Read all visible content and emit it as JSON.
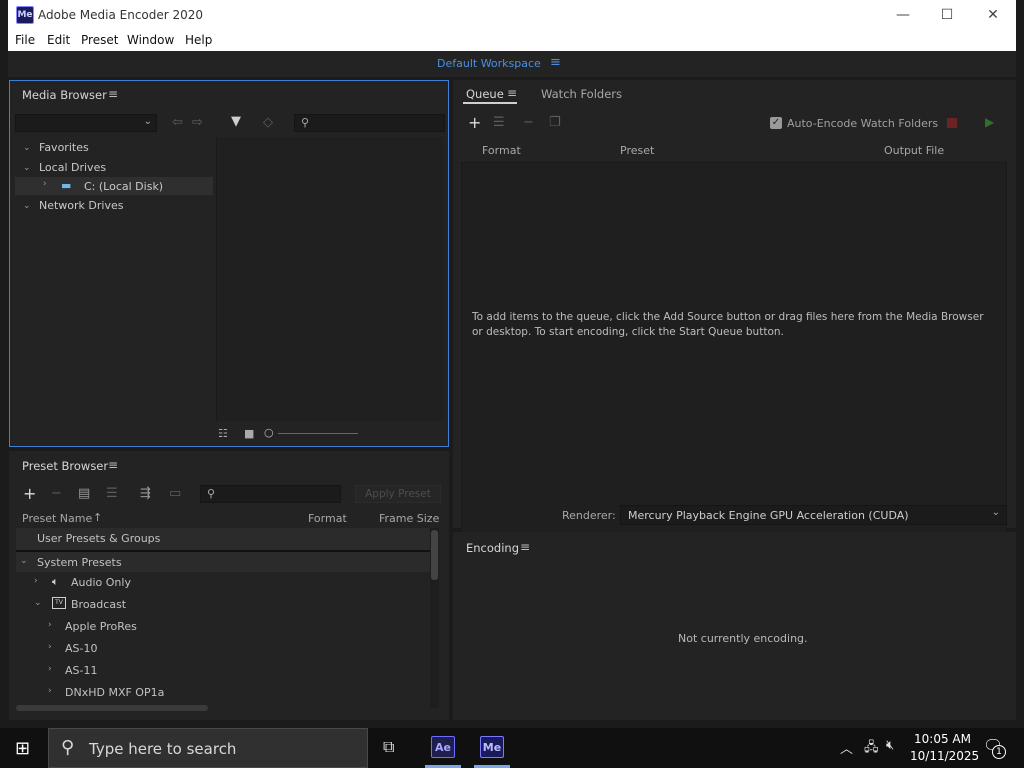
{
  "window": {
    "app_icon": "Me",
    "title": "Adobe Media Encoder 2020",
    "controls": {
      "minimize": "—",
      "maximize": "☐",
      "close": "✕"
    }
  },
  "menu": [
    "File",
    "Edit",
    "Preset",
    "Window",
    "Help"
  ],
  "workspace": {
    "label": "Default Workspace",
    "menu_icon": "≡"
  },
  "media_browser": {
    "title": "Media Browser",
    "tree": [
      {
        "label": "Favorites",
        "expanded": true
      },
      {
        "label": "Local Drives",
        "expanded": true
      },
      {
        "label": "C: (Local Disk)",
        "expanded": false
      },
      {
        "label": "Network Drives",
        "expanded": true
      }
    ]
  },
  "queue": {
    "tabs": [
      "Queue",
      "Watch Folders"
    ],
    "auto_encode_label": "Auto-Encode Watch Folders",
    "auto_encode_checked": true,
    "columns": [
      "Format",
      "Preset",
      "Output File"
    ],
    "empty_message": "To add items to the queue, click the Add Source button or drag files here from the Media Browser or desktop.  To start encoding, click the Start Queue button.",
    "renderer_label": "Renderer:",
    "renderer_value": "Mercury Playback Engine GPU Acceleration (CUDA)"
  },
  "encoding": {
    "title": "Encoding",
    "status": "Not currently encoding."
  },
  "preset_browser": {
    "title": "Preset Browser",
    "apply_button": "Apply Preset",
    "columns": [
      "Preset Name",
      "Format",
      "Frame Size"
    ],
    "groups": [
      "User Presets & Groups",
      "System Presets"
    ],
    "items": [
      "Audio Only",
      "Broadcast",
      "Apple ProRes",
      "AS-10",
      "AS-11",
      "DNxHD MXF OP1a"
    ],
    "broadcast_icon_text": "TV"
  },
  "taskbar": {
    "search_placeholder": "Type here to search",
    "apps": [
      "Ae",
      "Me"
    ],
    "time": "10:05 AM",
    "date": "10/11/2025",
    "notification_count": "1"
  },
  "colors": {
    "accent": "#4a90e2",
    "panel": "#232323",
    "bg": "#1b1b1b"
  }
}
